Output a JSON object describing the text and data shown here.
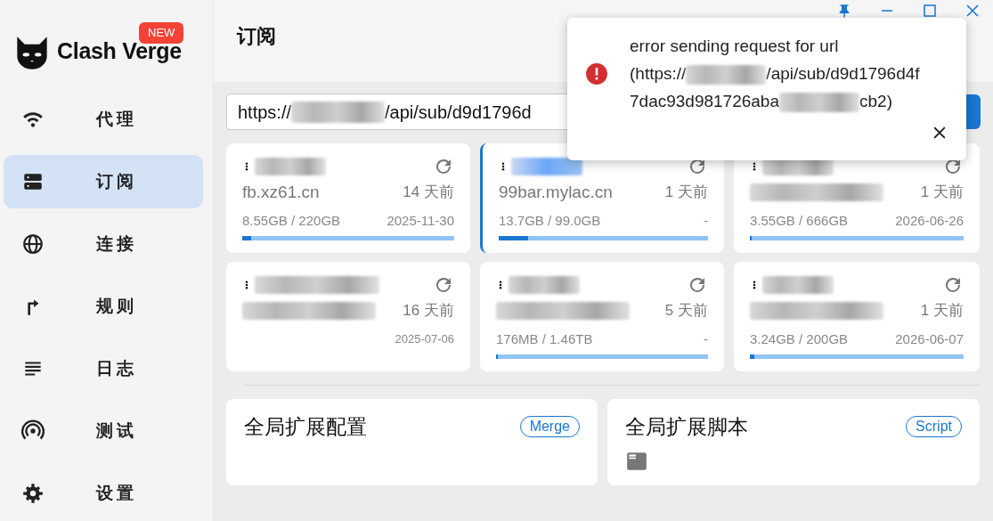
{
  "app": {
    "logo_text": "Clash Verge",
    "badge": "NEW"
  },
  "nav": [
    {
      "label": "代理",
      "selected": false
    },
    {
      "label": "订阅",
      "selected": true
    },
    {
      "label": "连接",
      "selected": false
    },
    {
      "label": "规则",
      "selected": false
    },
    {
      "label": "日志",
      "selected": false
    },
    {
      "label": "测试",
      "selected": false
    },
    {
      "label": "设置",
      "selected": false
    }
  ],
  "page_title": "订阅",
  "url_input": {
    "prefix": "https://",
    "suffix": "/api/sub/d9d1796d"
  },
  "profiles": [
    {
      "host": "fb.xz61.cn",
      "updated": "14 天前",
      "usage": "8.55GB / 220GB",
      "expire": "2025-11-30",
      "level": 0.04,
      "selected": false
    },
    {
      "host": "99bar.mylac.cn",
      "updated": "1 天前",
      "usage": "13.7GB / 99.0GB",
      "expire": "-",
      "level": 0.14,
      "selected": true
    },
    {
      "updated": "1 天前",
      "usage": "3.55GB / 666GB",
      "expire": "2026-06-26",
      "level": 0.01,
      "selected": false
    },
    {
      "updated": "16 天前",
      "expire": "2025-07-06",
      "selected": false
    },
    {
      "updated": "5 天前",
      "usage": "176MB / 1.46TB",
      "expire": "-",
      "level": 0.01,
      "selected": false
    },
    {
      "updated": "1 天前",
      "usage": "3.24GB / 200GB",
      "expire": "2026-06-07",
      "level": 0.02,
      "selected": false
    }
  ],
  "extensions": [
    {
      "title": "全局扩展配置",
      "tag": "Merge",
      "kind": "merge"
    },
    {
      "title": "全局扩展脚本",
      "tag": "Script",
      "kind": "script"
    }
  ],
  "toast": {
    "segments": [
      {
        "kind": "text",
        "text": "error sending request for url"
      },
      {
        "kind": "break"
      },
      {
        "kind": "text",
        "text": "(https://"
      },
      {
        "kind": "redacted"
      },
      {
        "kind": "text",
        "text": "/api/sub/d9d1796d4f"
      },
      {
        "kind": "break"
      },
      {
        "kind": "text",
        "text": "7dac93d981726aba"
      },
      {
        "kind": "redacted"
      },
      {
        "kind": "text",
        "text": "cb2)"
      }
    ]
  }
}
